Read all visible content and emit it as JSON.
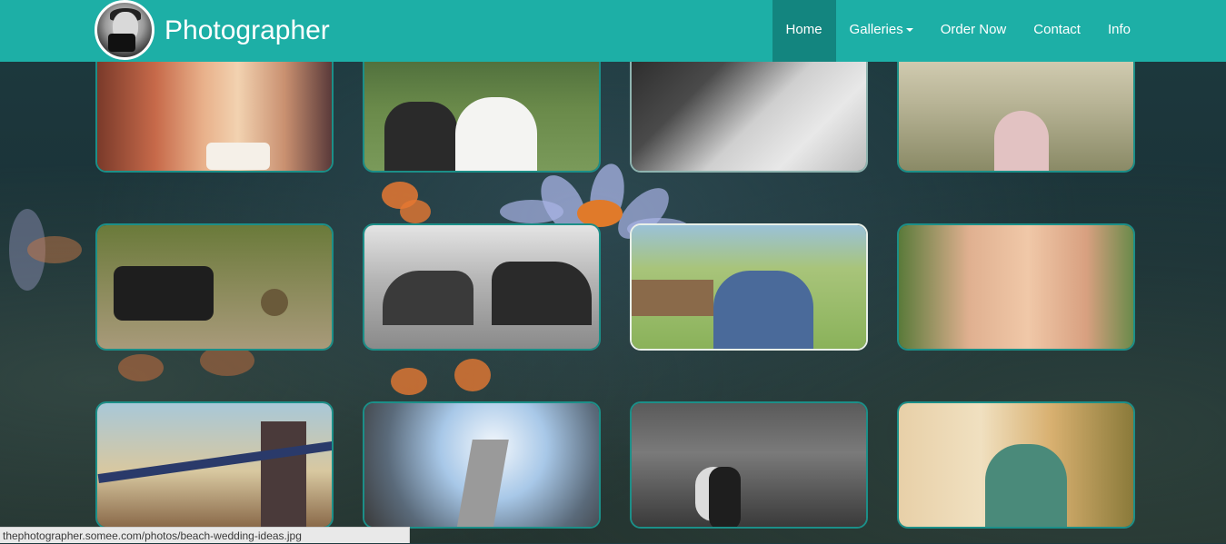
{
  "brand": {
    "title": "Photographer"
  },
  "nav": {
    "items": [
      {
        "label": "Home",
        "active": true
      },
      {
        "label": "Galleries",
        "dropdown": true
      },
      {
        "label": "Order Now"
      },
      {
        "label": "Contact"
      },
      {
        "label": "Info"
      }
    ]
  },
  "colors": {
    "navbar": "#1dafa6",
    "nav_active": "#13857f",
    "thumb_border": "#1c8f88"
  },
  "gallery": {
    "photos": [
      {
        "subject": "birthday-party-photo"
      },
      {
        "subject": "bride-groom-lake-photo"
      },
      {
        "subject": "bride-lying-veil-photo"
      },
      {
        "subject": "two-girls-lake-photo"
      },
      {
        "subject": "camera-and-birds-photo"
      },
      {
        "subject": "couple-black-white-photo"
      },
      {
        "subject": "family-farm-photo"
      },
      {
        "subject": "family-portrait-photo"
      },
      {
        "subject": "tower-bridge-photo"
      },
      {
        "subject": "skyscraper-fisheye-photo"
      },
      {
        "subject": "couple-stormy-sky-photo"
      },
      {
        "subject": "family-autumn-field-photo"
      }
    ]
  },
  "status": {
    "url": "thephotographer.somee.com/photos/beach-wedding-ideas.jpg"
  }
}
